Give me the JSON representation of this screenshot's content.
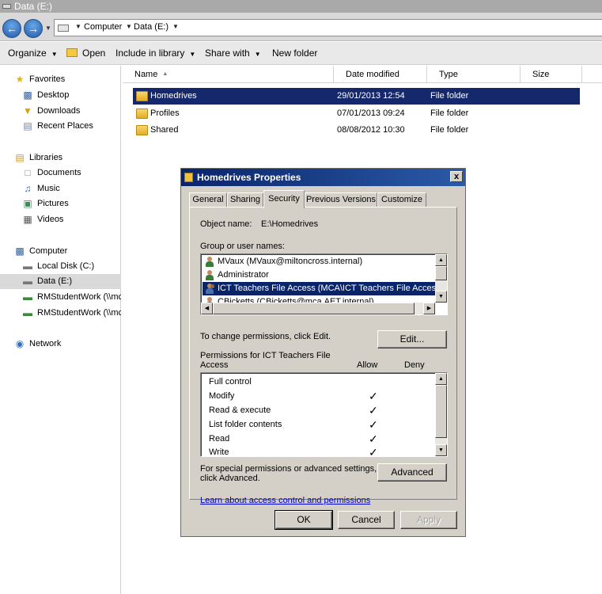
{
  "window": {
    "title": "Data (E:)"
  },
  "address": {
    "crumbs": [
      "Computer",
      "Data (E:)"
    ]
  },
  "toolbar": {
    "organize": "Organize",
    "open": "Open",
    "include_in_library": "Include in library",
    "share_with": "Share with",
    "new_folder": "New folder"
  },
  "navpane": {
    "favorites": "Favorites",
    "desktop": "Desktop",
    "downloads": "Downloads",
    "recent_places": "Recent Places",
    "libraries": "Libraries",
    "documents": "Documents",
    "music": "Music",
    "pictures": "Pictures",
    "videos": "Videos",
    "computer": "Computer",
    "local_disk": "Local Disk (C:)",
    "data_e": "Data (E:)",
    "rmstudent1": "RMStudentWork (\\\\mc",
    "rmstudent2": "RMStudentWork (\\\\mc",
    "network": "Network"
  },
  "filelist": {
    "columns": [
      "Name",
      "Date modified",
      "Type",
      "Size"
    ],
    "rows": [
      {
        "name": "Homedrives",
        "date": "29/01/2013 12:54",
        "type": "File folder"
      },
      {
        "name": "Profiles",
        "date": "07/01/2013 09:24",
        "type": "File folder"
      },
      {
        "name": "Shared",
        "date": "08/08/2012 10:30",
        "type": "File folder"
      }
    ]
  },
  "dialog": {
    "title": "Homedrives Properties",
    "close": "x",
    "tabs": [
      "General",
      "Sharing",
      "Security",
      "Previous Versions",
      "Customize"
    ],
    "object_name_label": "Object name:",
    "object_name_value": "E:\\Homedrives",
    "group_label": "Group or user names:",
    "users": [
      "MVaux (MVaux@miltoncross.internal)",
      "Administrator",
      "ICT Teachers File Access (MCA\\ICT Teachers File Access",
      "CBicketts (CBicketts@mca.AET.internal)"
    ],
    "change_hint": "To change permissions, click Edit.",
    "edit_button": "Edit...",
    "permissions_label_1": "Permissions for ICT Teachers File",
    "permissions_label_2": "Access",
    "allow_header": "Allow",
    "deny_header": "Deny",
    "permissions": [
      {
        "name": "Full control",
        "allow": ""
      },
      {
        "name": "Modify",
        "allow": "✓"
      },
      {
        "name": "Read & execute",
        "allow": "✓"
      },
      {
        "name": "List folder contents",
        "allow": "✓"
      },
      {
        "name": "Read",
        "allow": "✓"
      },
      {
        "name": "Write",
        "allow": "✓"
      }
    ],
    "special_hint_1": "For special permissions or advanced settings,",
    "special_hint_2": "click Advanced.",
    "advanced_button": "Advanced",
    "learn_link": "Learn about access control and permissions",
    "ok": "OK",
    "cancel": "Cancel",
    "apply": "Apply"
  }
}
